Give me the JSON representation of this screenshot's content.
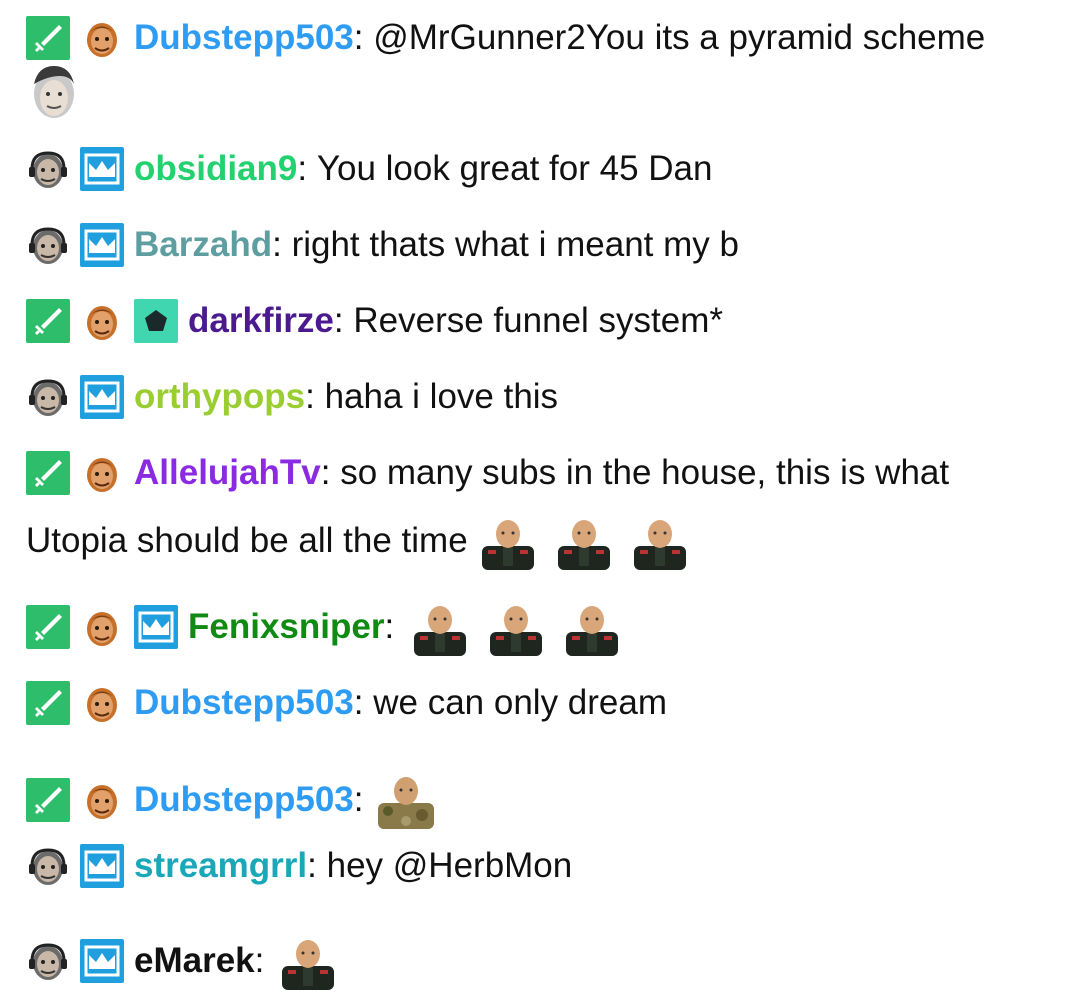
{
  "chat": {
    "messages": [
      {
        "username": "Dubstepp503",
        "color": "#2e9cf2",
        "text": "@MrGunner2You its a pyramid scheme",
        "badges": [
          "moderator-sword-icon",
          "face-badge-icon"
        ]
      },
      {
        "username": "obsidian9",
        "color": "#23d16f",
        "text": "You look great for 45 Dan",
        "badges": [
          "face-badge-icon",
          "subscriber-crown-icon"
        ]
      },
      {
        "username": "Barzahd",
        "color": "#5f9ea0",
        "text": "right thats what i meant my b",
        "badges": [
          "face-badge-icon",
          "subscriber-crown-icon"
        ]
      },
      {
        "username": "darkfirze",
        "color": "#4b1a8f",
        "text": "Reverse funnel system*",
        "badges": [
          "moderator-sword-icon",
          "face-badge-icon",
          "turbo-pentagon-icon"
        ]
      },
      {
        "username": "orthypops",
        "color": "#9acd32",
        "text": "haha i love this",
        "badges": [
          "face-badge-icon",
          "subscriber-crown-icon"
        ]
      },
      {
        "username": "AllelujahTv",
        "color": "#8a2be2",
        "text": "so many subs in the house, this is what",
        "text_line2": "Utopia should be all the time",
        "badges": [
          "moderator-sword-icon",
          "face-badge-icon"
        ]
      },
      {
        "username": "Fenixsniper",
        "color": "#0f8a12",
        "text": "",
        "badges": [
          "moderator-sword-icon",
          "face-badge-icon",
          "subscriber-crown-icon"
        ]
      },
      {
        "username": "Dubstepp503",
        "color": "#2e9cf2",
        "text": "we can only dream",
        "badges": [
          "moderator-sword-icon",
          "face-badge-icon"
        ]
      },
      {
        "username": "Dubstepp503",
        "color": "#2e9cf2",
        "text": "",
        "badges": [
          "moderator-sword-icon",
          "face-badge-icon"
        ]
      },
      {
        "username": "streamgrrl",
        "color": "#1aa7b8",
        "text": "hey @HerbMon",
        "badges": [
          "face-badge-icon",
          "subscriber-crown-icon"
        ]
      },
      {
        "username": "eMarek",
        "color": "#111111",
        "text": "",
        "badges": [
          "face-badge-icon",
          "subscriber-crown-icon"
        ]
      }
    ],
    "separator": ":"
  },
  "colors": {
    "moderator_badge": "#2ebd6b",
    "subscriber_badge": "#1f9fde",
    "turbo_badge": "#3fd6b0",
    "face_badge_skin": "#c7702a"
  }
}
